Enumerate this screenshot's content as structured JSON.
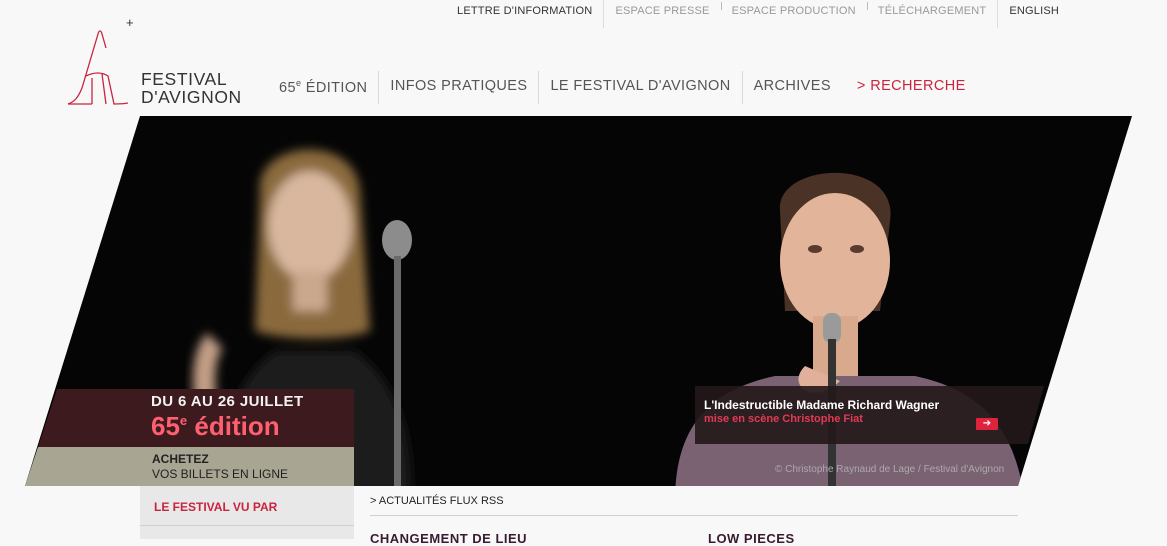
{
  "topbar": {
    "items": [
      {
        "label": "LETTRE D'INFORMATION"
      },
      {
        "label": "ESPACE PRESSE"
      },
      {
        "label": "ESPACE PRODUCTION"
      },
      {
        "label": "TÉLÉCHARGEMENT"
      },
      {
        "label": "ENGLISH"
      }
    ]
  },
  "logo": {
    "plus": "+",
    "line1": "FESTIVAL",
    "line2": "D'AVIGNON"
  },
  "nav": {
    "edition_number": "65",
    "edition_sup": "e",
    "edition_word": " ÉDITION",
    "infos": "INFOS PRATIQUES",
    "festival": "LE FESTIVAL D'AVIGNON",
    "archives": "ARCHIVES",
    "search": "> RECHERCHE"
  },
  "hero": {
    "credit": "© Christophe Raynaud de Lage / Festival d'Avignon",
    "dates": "DU 6 AU 26 JUILLET",
    "edition_number": "65",
    "edition_sup": "e",
    "edition_word": " édition",
    "tickets_line1": "ACHETEZ",
    "tickets_line2": "VOS BILLETS EN LIGNE",
    "show_title": "L'Indestructible Madame Richard Wagner",
    "show_subtitle": "mise en scène Christophe Fiat"
  },
  "sidebar": {
    "item1": "LE FESTIVAL VU PAR"
  },
  "news": {
    "rss": "> ACTUALITÉS FLUX RSS",
    "headline1": "CHANGEMENT DE LIEU",
    "headline2": "LOW PIECES"
  },
  "colors": {
    "accent": "#c8243f",
    "dark_panel": "#3c1a1e",
    "tickets_panel": "#a8a693",
    "edition_red": "#ff6070"
  }
}
